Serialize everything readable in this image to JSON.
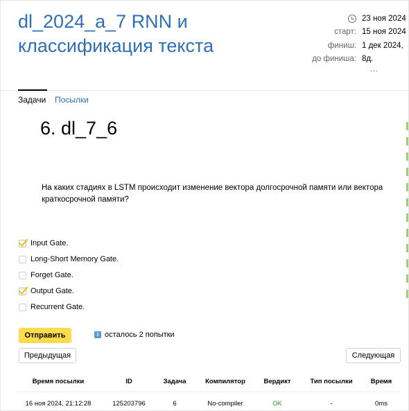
{
  "contest": {
    "title": "dl_2024_a_7 RNN и классификация текста",
    "time_icon": "clock-icon",
    "current_time": "23 ноя 2024",
    "start_label": "старт:",
    "start": "15 ноя 2024",
    "finish_label": "финиш:",
    "finish": "1 дек 2024,",
    "remaining_label": "до финиша:",
    "remaining": "8д.",
    "more": "..."
  },
  "tabs": [
    {
      "label": "Задачи",
      "active": true
    },
    {
      "label": "Посылки",
      "active": false
    }
  ],
  "problem": {
    "title": "6. dl_7_6",
    "question": "На каких стадиях в LSTM происходит изменение вектора долгосрочной памяти или вектора краткосрочной памяти?",
    "options": [
      {
        "label": "Input Gate.",
        "checked": true
      },
      {
        "label": "Long-Short Memory Gate.",
        "checked": false
      },
      {
        "label": "Forget Gate.",
        "checked": false
      },
      {
        "label": "Output Gate.",
        "checked": true
      },
      {
        "label": "Recurrent Gate.",
        "checked": false
      }
    ]
  },
  "actions": {
    "submit_label": "Отправить",
    "attempts_icon": "info-icon",
    "attempts_text": "осталось 2 попытки",
    "prev_label": "Предыдущая",
    "next_label": "Следующая"
  },
  "submissions": {
    "headers": [
      "Время посылки",
      "ID",
      "Задача",
      "Компилятор",
      "Вердикт",
      "Тип посылки",
      "Время"
    ],
    "rows": [
      [
        "16 ноя 2024, 21:12:28",
        "125203796",
        "6",
        "No-compiler",
        "OK",
        "-",
        "0ms"
      ]
    ]
  },
  "colors": {
    "link": "#2f6fb4",
    "submit_button": "#ffdb4d",
    "verdict_ok": "#2aa02a",
    "checkmark": "#f0c200"
  }
}
